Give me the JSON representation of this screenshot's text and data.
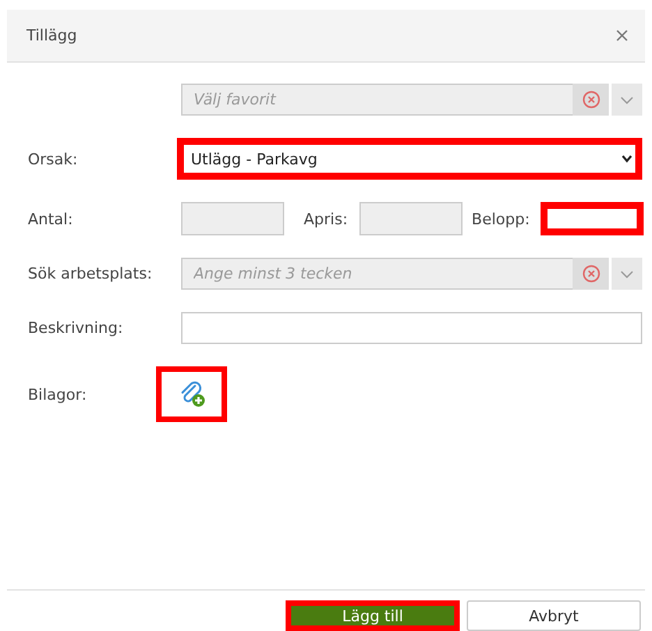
{
  "dialog": {
    "title": "Tillägg"
  },
  "rows": [
    {
      "kind": "combo",
      "placeholder": "Välj favorit"
    },
    {
      "kind": "select",
      "label": "Orsak:",
      "value": "Utlägg - Parkavg",
      "highlighted": true
    },
    {
      "kind": "amounts",
      "label": "Antal:",
      "disabled": true,
      "highlighted": false,
      "extra": [
        {
          "label": "Apris:",
          "disabled": true,
          "highlighted": false
        },
        {
          "label": "Belopp:",
          "disabled": false,
          "highlighted": true
        }
      ]
    },
    {
      "kind": "combo",
      "label": "Sök arbetsplats:",
      "placeholder": "Ange minst 3 tecken"
    },
    {
      "kind": "text",
      "label": "Beskrivning:"
    },
    {
      "kind": "attach",
      "label": "Bilagor:",
      "highlighted": true
    }
  ],
  "buttons": [
    {
      "label": "Lägg till",
      "kind": "primary",
      "highlighted": true
    },
    {
      "label": "Avbryt",
      "kind": "secondary",
      "highlighted": false
    }
  ]
}
